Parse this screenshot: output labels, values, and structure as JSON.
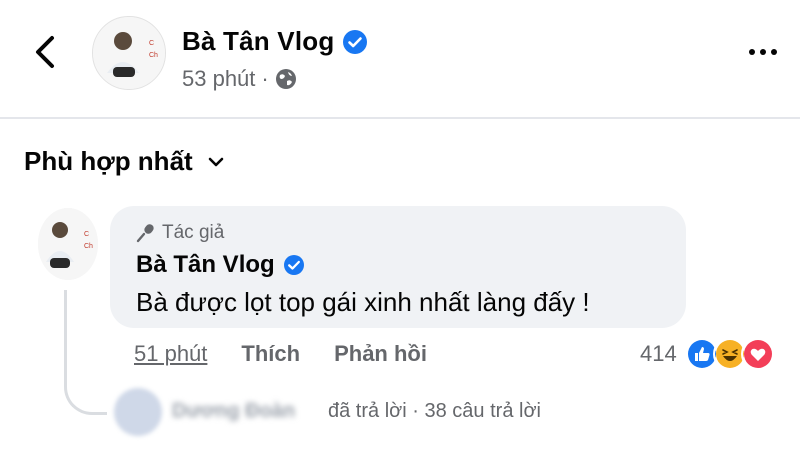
{
  "header": {
    "page_name": "Bà Tân Vlog",
    "post_time": "53 phút",
    "separator": "·",
    "privacy_icon": "globe-icon",
    "back_icon": "chevron-left-icon",
    "more_icon": "more-dots-icon"
  },
  "sort": {
    "label": "Phù hợp nhất",
    "icon": "chevron-down-icon"
  },
  "comment": {
    "badge_label": "Tác giả",
    "badge_icon": "microphone-icon",
    "author": "Bà Tân Vlog",
    "text": "Bà được lọt top gái xinh nhất làng đấy !",
    "time": "51 phút",
    "like_label": "Thích",
    "reply_label": "Phản hồi",
    "reaction_count": "414",
    "reactions": [
      "like-reaction-icon",
      "haha-reaction-icon",
      "love-reaction-icon"
    ]
  },
  "reply_summary": {
    "name": "Dương Đoàn",
    "text": "đã trả lời",
    "separator": "·",
    "count_text": "38 câu trả lời"
  },
  "colors": {
    "verified": "#1877f2",
    "like": "#1877f2",
    "haha": "#f7b125",
    "love": "#f33e58",
    "secondary_text": "#65676b",
    "bubble": "#f0f2f5"
  }
}
